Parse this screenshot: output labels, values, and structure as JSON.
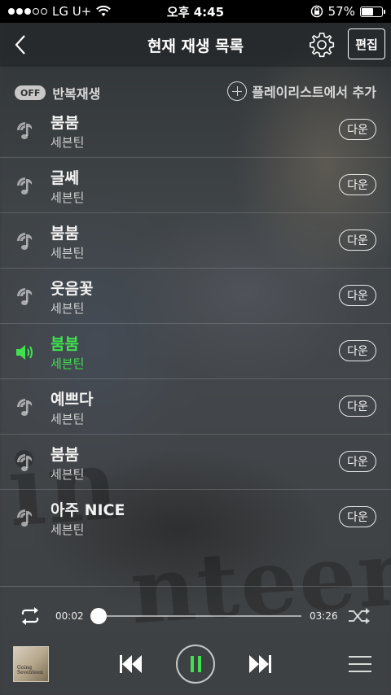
{
  "status": {
    "carrier": "LG U+",
    "time": "오후 4:45",
    "battery": "57%",
    "battery_level": 0.57
  },
  "nav": {
    "title": "현재 재생 목록",
    "edit_label": "편집"
  },
  "options": {
    "off_label": "OFF",
    "repeat_label": "반복재생",
    "add_playlist_label": "플레이리스트에서 추가"
  },
  "playlist": [
    {
      "title": "붐붐",
      "artist": "세븐틴",
      "down": "다운",
      "active": false
    },
    {
      "title": "글쎄",
      "artist": "세븐틴",
      "down": "다운",
      "active": false
    },
    {
      "title": "붐붐",
      "artist": "세븐틴",
      "down": "다운",
      "active": false
    },
    {
      "title": "웃음꽃",
      "artist": "세븐틴",
      "down": "다운",
      "active": false
    },
    {
      "title": "붐붐",
      "artist": "세븐틴",
      "down": "다운",
      "active": true
    },
    {
      "title": "예쁘다",
      "artist": "세븐틴",
      "down": "다운",
      "active": false
    },
    {
      "title": "붐붐",
      "artist": "세븐틴",
      "down": "다운",
      "active": false
    },
    {
      "title": "아주 NICE",
      "artist": "세븐틴",
      "down": "다운",
      "active": false
    }
  ],
  "player": {
    "current_time": "00:02",
    "total_time": "03:26",
    "progress": 0.01,
    "album_text": "Going Seventeen"
  },
  "colors": {
    "accent": "#3fe24e"
  }
}
